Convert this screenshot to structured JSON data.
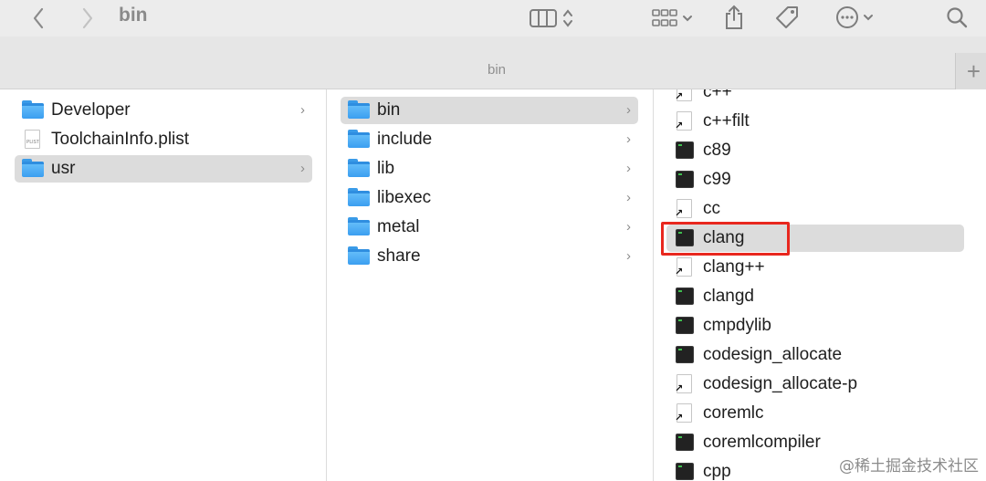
{
  "window": {
    "title": "bin",
    "path_label": "bin",
    "new_tab": "+"
  },
  "toolbar": {
    "back_icon": "chevron-left-icon",
    "forward_icon": "chevron-right-icon",
    "view_icon": "column-view-icon",
    "group_icon": "grid-group-icon",
    "share_icon": "share-icon",
    "tag_icon": "tag-icon",
    "more_icon": "ellipsis-circle-icon",
    "search_icon": "search-icon"
  },
  "columns": {
    "col1": [
      {
        "label": "Developer",
        "kind": "folder",
        "chevron": "›"
      },
      {
        "label": "ToolchainInfo.plist",
        "kind": "plist"
      },
      {
        "label": "usr",
        "kind": "folder",
        "chevron": "›",
        "selected": true
      }
    ],
    "col2": [
      {
        "label": "bin",
        "kind": "folder",
        "chevron": "›",
        "selected": true
      },
      {
        "label": "include",
        "kind": "folder",
        "chevron": "›"
      },
      {
        "label": "lib",
        "kind": "folder",
        "chevron": "›"
      },
      {
        "label": "libexec",
        "kind": "folder",
        "chevron": "›"
      },
      {
        "label": "metal",
        "kind": "folder",
        "chevron": "›"
      },
      {
        "label": "share",
        "kind": "folder",
        "chevron": "›"
      }
    ],
    "col3": [
      {
        "label": "c++",
        "kind": "alias"
      },
      {
        "label": "c++filt",
        "kind": "alias"
      },
      {
        "label": "c89",
        "kind": "exec"
      },
      {
        "label": "c99",
        "kind": "exec"
      },
      {
        "label": "cc",
        "kind": "alias"
      },
      {
        "label": "clang",
        "kind": "exec",
        "selected": true
      },
      {
        "label": "clang++",
        "kind": "alias"
      },
      {
        "label": "clangd",
        "kind": "exec"
      },
      {
        "label": "cmpdylib",
        "kind": "exec"
      },
      {
        "label": "codesign_allocate",
        "kind": "exec"
      },
      {
        "label": "codesign_allocate-p",
        "kind": "alias"
      },
      {
        "label": "coremlc",
        "kind": "alias"
      },
      {
        "label": "coremlcompiler",
        "kind": "exec"
      },
      {
        "label": "cpp",
        "kind": "exec"
      }
    ]
  },
  "watermark": "@稀土掘金技术社区",
  "colors": {
    "accent_red": "#e8271e",
    "folder_blue": "#3b9ef0",
    "selection_gray": "#dcdcdc"
  }
}
